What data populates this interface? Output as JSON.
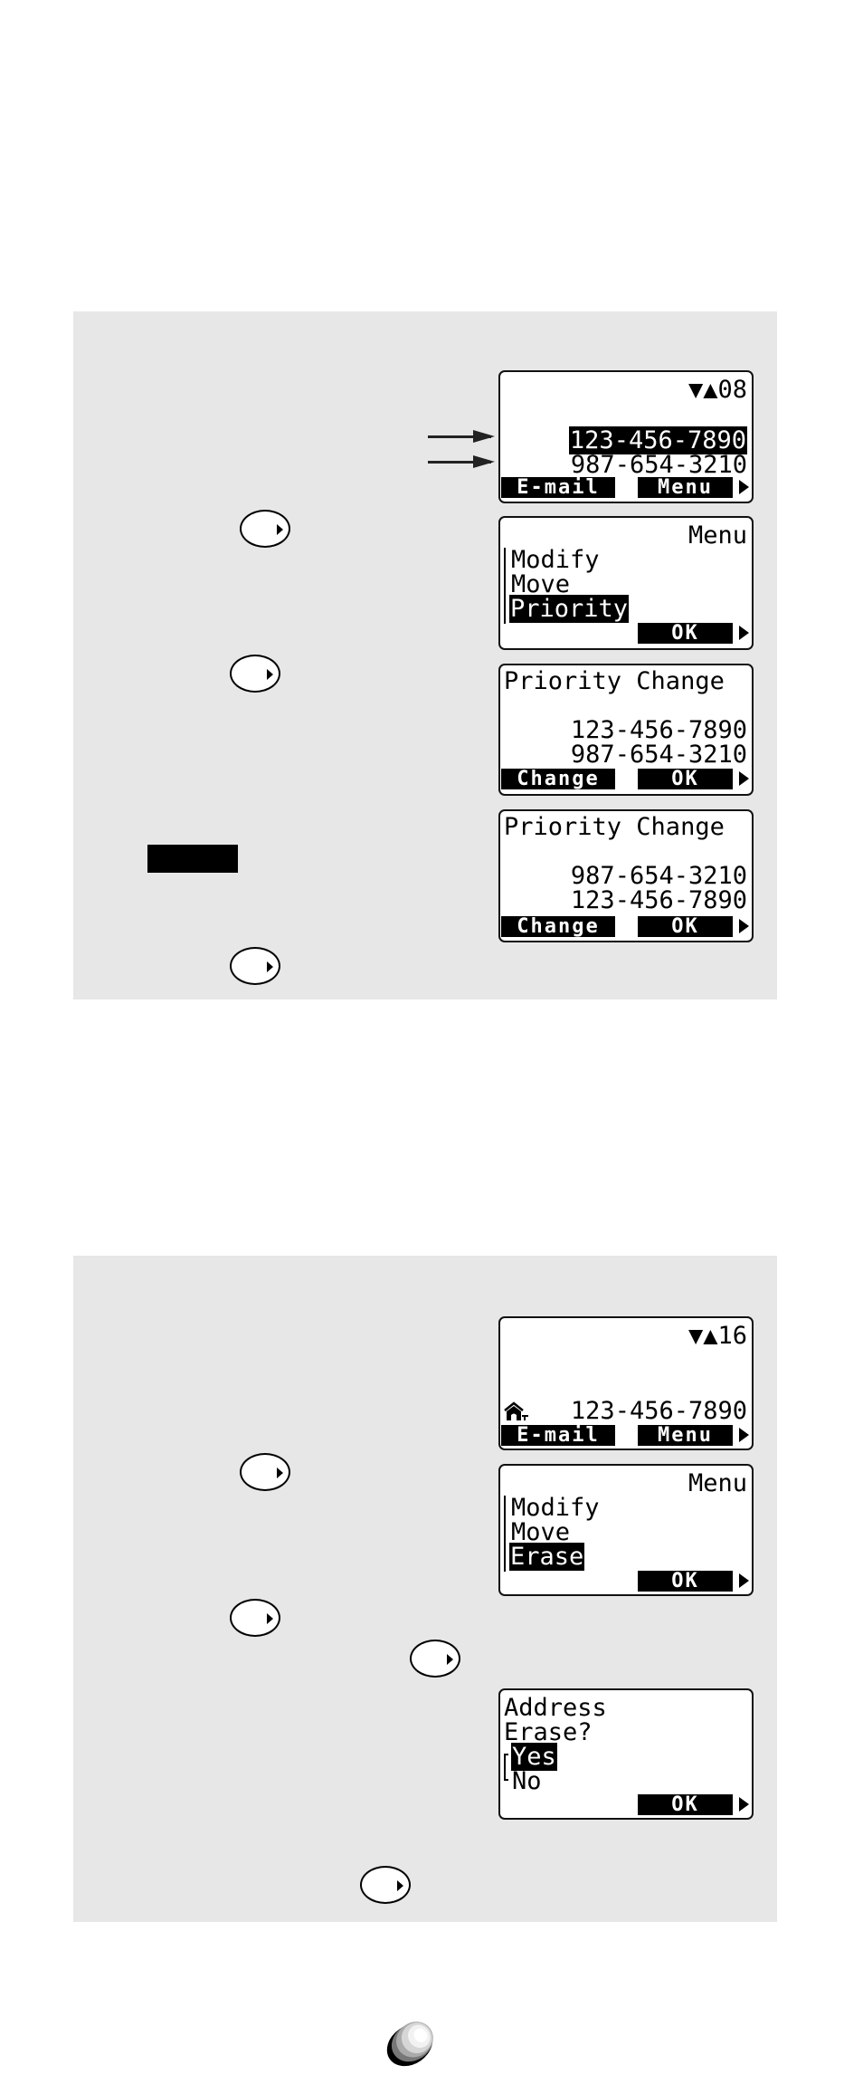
{
  "section_priority": {
    "screen_list": {
      "counter_arrows": "▼▲",
      "counter": "08",
      "numbers": [
        "123-456-7890",
        "987-654-3210"
      ],
      "highlighted_index": 0,
      "softkey_left": "E-mail",
      "softkey_right": "Menu"
    },
    "screen_menu": {
      "title": "Menu",
      "items": [
        "Modify",
        "Move",
        "Priority"
      ],
      "selected_index": 2,
      "softkey_right": "OK"
    },
    "screen_priority_before": {
      "title": "Priority Change",
      "numbers": [
        "123-456-7890",
        "987-654-3210"
      ],
      "softkey_left": "Change",
      "softkey_right": "OK"
    },
    "screen_priority_after": {
      "title": "Priority Change",
      "numbers": [
        "987-654-3210",
        "123-456-7890"
      ],
      "softkey_left": "Change",
      "softkey_right": "OK"
    }
  },
  "section_erase": {
    "screen_list": {
      "counter_arrows": "▼▲",
      "counter": "16",
      "type_icon": "home-icon",
      "number": "123-456-7890",
      "softkey_left": "E-mail",
      "softkey_right": "Menu"
    },
    "screen_menu": {
      "title": "Menu",
      "items": [
        "Modify",
        "Move",
        "Erase"
      ],
      "selected_index": 2,
      "softkey_right": "OK"
    },
    "screen_confirm": {
      "line1": "Address",
      "line2": "Erase?",
      "options": [
        "Yes",
        "No"
      ],
      "selected_index": 0,
      "softkey_right": "OK"
    }
  },
  "colors": {
    "panel_background": "#e7e7e7",
    "lcd_background": "#ffffff",
    "ink": "#000000"
  }
}
